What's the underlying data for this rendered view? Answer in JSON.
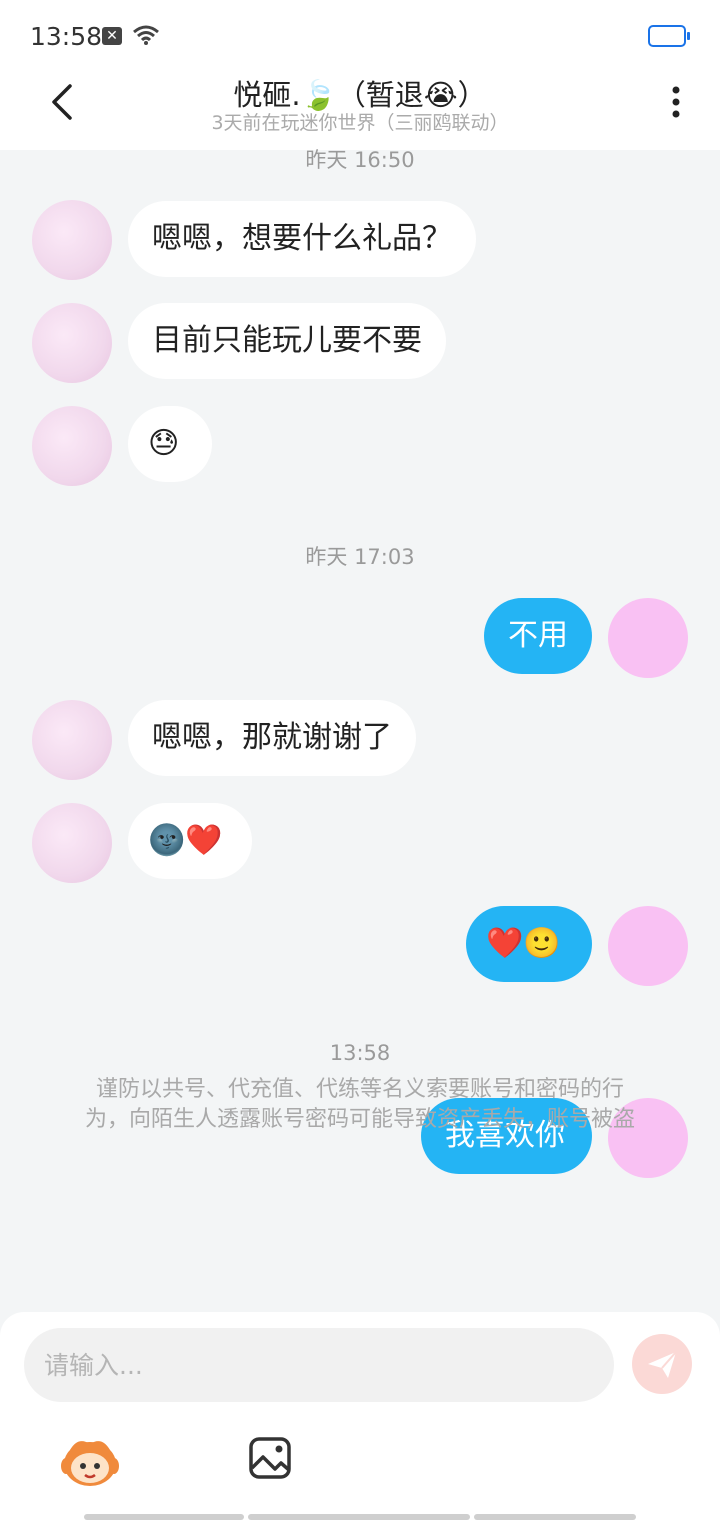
{
  "status_bar": {
    "time": "13:58"
  },
  "header": {
    "title": "悦砸.🍃（暂退😭）",
    "subtitle": "3天前在玩迷你世界（三丽鸥联动）"
  },
  "timestamps": [
    "昨天 16:50",
    "昨天 17:03",
    "13:58"
  ],
  "messages": [
    {
      "side": "left",
      "text": "嗯嗯，想要什么礼品？"
    },
    {
      "side": "left",
      "text": "目前只能玩儿要不要"
    },
    {
      "side": "left",
      "text": "😓"
    },
    {
      "side": "right",
      "text": "不用"
    },
    {
      "side": "left",
      "text": "嗯嗯，那就谢谢了"
    },
    {
      "side": "left",
      "text": "🌚❤️"
    },
    {
      "side": "right",
      "text": "❤️🙂"
    },
    {
      "side": "right",
      "text": "我喜欢你"
    }
  ],
  "warning": {
    "line1": "谨防以共号、代充值、代练等名义索要账号和密码的行",
    "line2": "为，向陌生人透露账号密码可能导致资产丢失，账号被盗"
  },
  "composer": {
    "placeholder": "请输入..."
  },
  "icons": [
    "back-icon",
    "more-icon",
    "send-icon",
    "mascot-icon",
    "image-icon",
    "wifi-icon",
    "battery-icon"
  ],
  "colors": {
    "accent": "#24b4f4",
    "send_disabled": "#fbd9d6",
    "background": "#f3f5f6"
  }
}
